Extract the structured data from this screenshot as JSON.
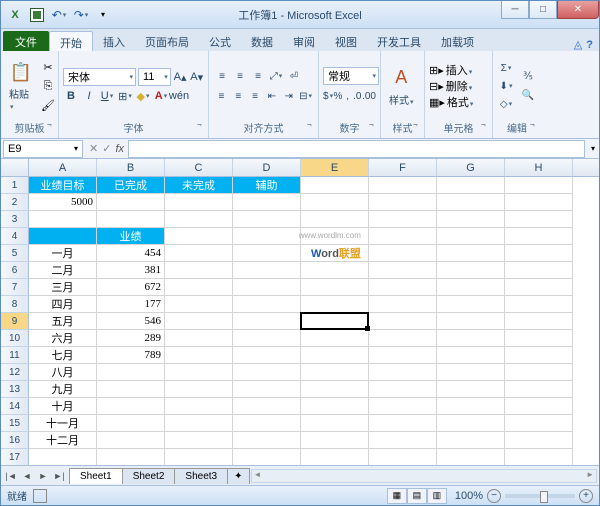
{
  "title": "工作簿1 - Microsoft Excel",
  "tabs": {
    "file": "文件",
    "home": "开始",
    "insert": "插入",
    "layout": "页面布局",
    "formulas": "公式",
    "data": "数据",
    "review": "审阅",
    "view": "视图",
    "dev": "开发工具",
    "addins": "加载项"
  },
  "ribbon": {
    "paste": "粘贴",
    "clipboard": "剪贴板",
    "font_group": "字体",
    "align_group": "对齐方式",
    "number_group": "数字",
    "style_group": "样式",
    "cell_group": "单元格",
    "edit_group": "编辑",
    "font_name": "宋体",
    "font_size": "11",
    "number_format": "常规",
    "styles": "样式",
    "insert": "插入",
    "delete": "删除",
    "format": "格式"
  },
  "namebox": "E9",
  "columns": [
    "A",
    "B",
    "C",
    "D",
    "E",
    "F",
    "G",
    "H"
  ],
  "hdr1": {
    "a": "业绩目标",
    "b": "已完成",
    "c": "未完成",
    "d": "辅助"
  },
  "r2a": "5000",
  "hdr4": "业绩",
  "months": {
    "m1": "一月",
    "m2": "二月",
    "m3": "三月",
    "m4": "四月",
    "m5": "五月",
    "m6": "六月",
    "m7": "七月",
    "m8": "八月",
    "m9": "九月",
    "m10": "十月",
    "m11": "十一月",
    "m12": "十二月"
  },
  "vals": {
    "v1": "454",
    "v2": "381",
    "v3": "672",
    "v4": "177",
    "v5": "546",
    "v6": "289",
    "v7": "789"
  },
  "sheets": {
    "s1": "Sheet1",
    "s2": "Sheet2",
    "s3": "Sheet3"
  },
  "status": "就绪",
  "zoom": "100%",
  "watermark": {
    "url": "www.wordlm.com",
    "w": "W",
    "ord": "ord",
    "lm": "联盟"
  },
  "chart_data": {
    "type": "table",
    "title": "业绩",
    "goal_header": [
      "业绩目标",
      "已完成",
      "未完成",
      "辅助"
    ],
    "goal_values": [
      5000,
      null,
      null,
      null
    ],
    "categories": [
      "一月",
      "二月",
      "三月",
      "四月",
      "五月",
      "六月",
      "七月",
      "八月",
      "九月",
      "十月",
      "十一月",
      "十二月"
    ],
    "values": [
      454,
      381,
      672,
      177,
      546,
      289,
      789,
      null,
      null,
      null,
      null,
      null
    ]
  }
}
